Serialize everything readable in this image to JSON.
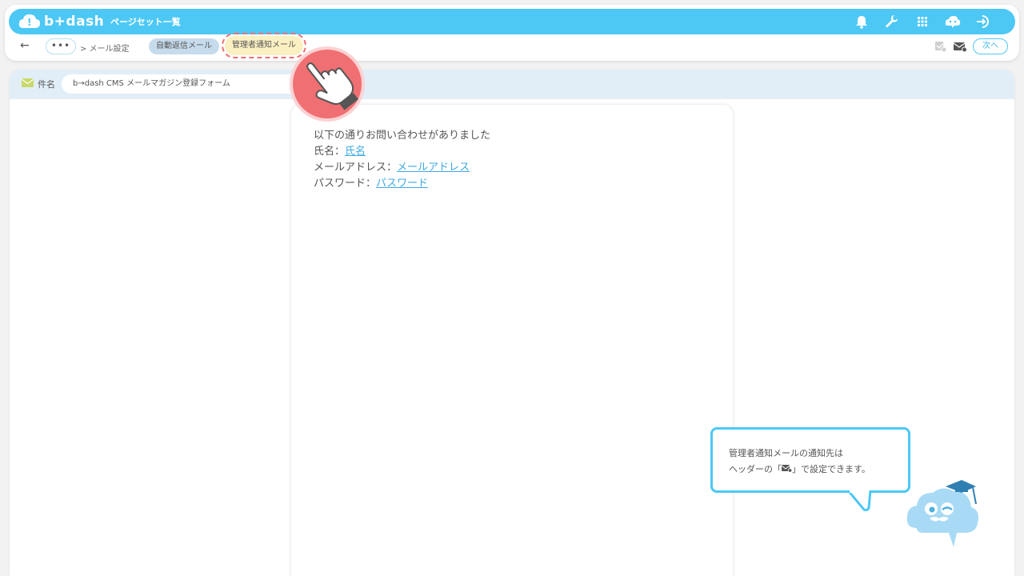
{
  "header": {
    "logo_text": "b+dash",
    "title": "ページセット一覧",
    "icons": [
      "bell-icon",
      "wrench-icon",
      "grid-icon",
      "support-cloud-icon",
      "logout-icon"
    ]
  },
  "subbar": {
    "back": "←",
    "more": "•••",
    "breadcrumb": "> メール設定",
    "tabs": [
      {
        "label": "自動返信メール"
      },
      {
        "label": "管理者通知メール"
      }
    ],
    "next": "次へ"
  },
  "subject": {
    "label": "件名",
    "value": "b→dash CMS メールマガジン登録フォーム"
  },
  "mail_body": {
    "line1": "以下の通りお問い合わせがありました",
    "name_label": "氏名：",
    "name_link": "氏名",
    "email_label": "メールアドレス：",
    "email_link": "メールアドレス",
    "password_label": "パスワード：",
    "password_link": "パスワード"
  },
  "tip": {
    "line1": "管理者通知メールの通知先は",
    "line2_pre": "ヘッダーの「",
    "line2_post": "」で設定できます。"
  },
  "colors": {
    "accent": "#4dc8f5",
    "highlight": "#f06f72",
    "link": "#3fa9e0"
  }
}
